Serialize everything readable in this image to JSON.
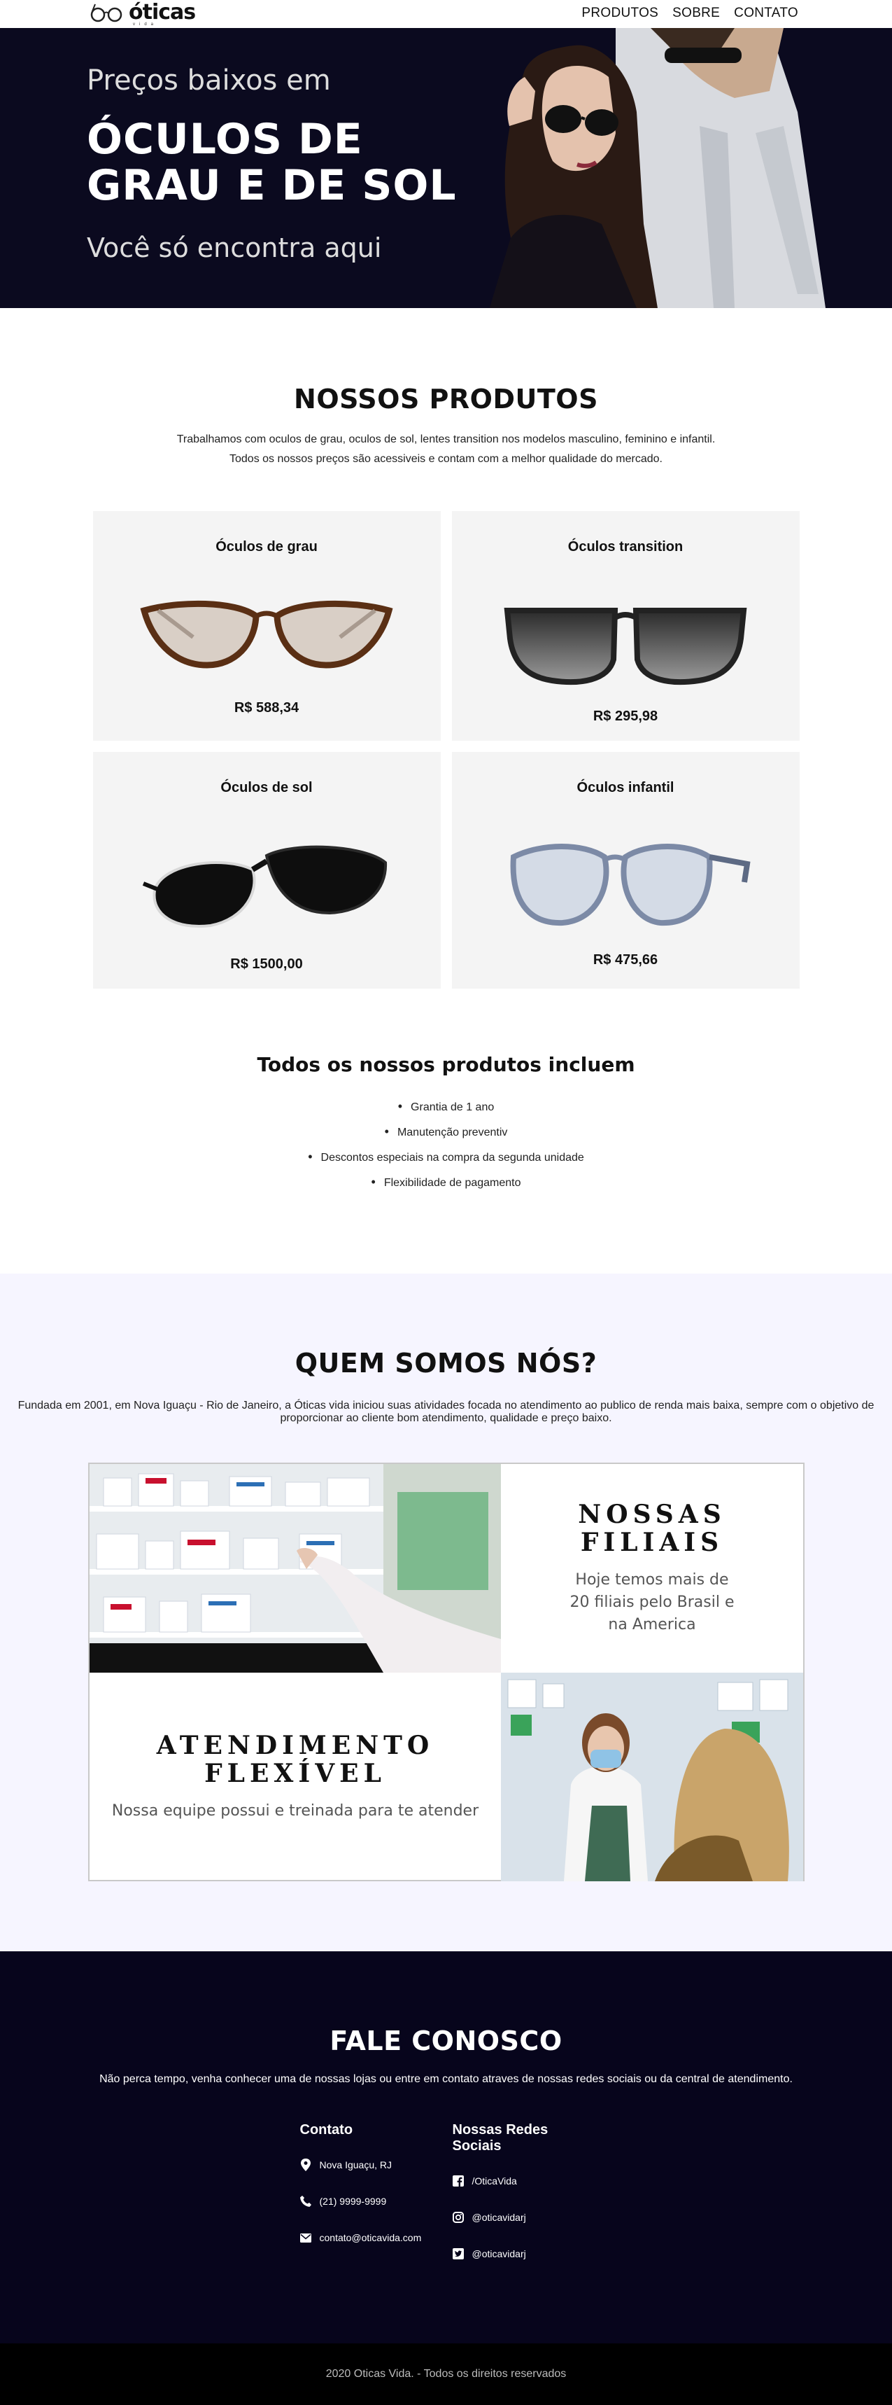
{
  "brand": {
    "name": "óticas",
    "tagline": "vida"
  },
  "nav": {
    "items": [
      "PRODUTOS",
      "SOBRE",
      "CONTATO"
    ]
  },
  "hero": {
    "pre": "Preços baixos em",
    "title_line1": "ÓCULOS DE",
    "title_line2": "GRAU E DE SOL",
    "sub": "Você só encontra aqui"
  },
  "products": {
    "title": "NOSSOS PRODUTOS",
    "intro_line1": "Trabalhamos com oculos de grau, oculos de sol, lentes transition nos modelos masculino, feminino e infantil.",
    "intro_line2": "Todos os nossos preços são acessiveis e contam com a melhor qualidade do mercado.",
    "items": [
      {
        "name": "Óculos de grau",
        "price": "R$ 588,34"
      },
      {
        "name": "Óculos transition",
        "price": "R$ 295,98"
      },
      {
        "name": "Óculos de sol",
        "price": "R$ 1500,00"
      },
      {
        "name": "Óculos infantil",
        "price": "R$ 475,66"
      }
    ],
    "includes_title": "Todos os nossos produtos incluem",
    "includes": [
      "Grantia de 1 ano",
      "Manutenção preventiv",
      "Descontos especiais na compra da segunda unidade",
      "Flexibilidade de pagamento"
    ]
  },
  "about": {
    "title": "QUEM SOMOS NÓS?",
    "text": "Fundada em 2001, em Nova Iguaçu - Rio de Janeiro, a Óticas vida iniciou suas atividades focada no atendimento ao publico de renda mais baixa, sempre com o objetivo de proporcionar ao cliente bom atendimento, qualidade e preço baixo.",
    "filiais_title": "NOSSAS FILIAIS",
    "filiais_text": "Hoje temos mais de 20 filiais pelo Brasil e na America",
    "atendimento_title_line1": "ATENDIMENTO",
    "atendimento_title_line2": "FLEXÍVEL",
    "atendimento_text": "Nossa equipe possui e treinada para te atender"
  },
  "contact": {
    "title": "FALE CONOSCO",
    "intro": "Não perca tempo, venha conhecer uma de nossas lojas ou entre em contato atraves de nossas redes sociais ou da central de atendimento.",
    "contato_heading": "Contato",
    "contato": {
      "address": "Nova Iguaçu, RJ",
      "phone": "(21) 9999-9999",
      "email": "contato@oticavida.com"
    },
    "social_heading": "Nossas Redes Sociais",
    "social": {
      "facebook": "/OticaVida",
      "instagram": "@oticavidarj",
      "twitter": "@oticavidarj"
    }
  },
  "footer": {
    "text": "2020 Oticas Vida. - Todos os direitos reservados"
  }
}
